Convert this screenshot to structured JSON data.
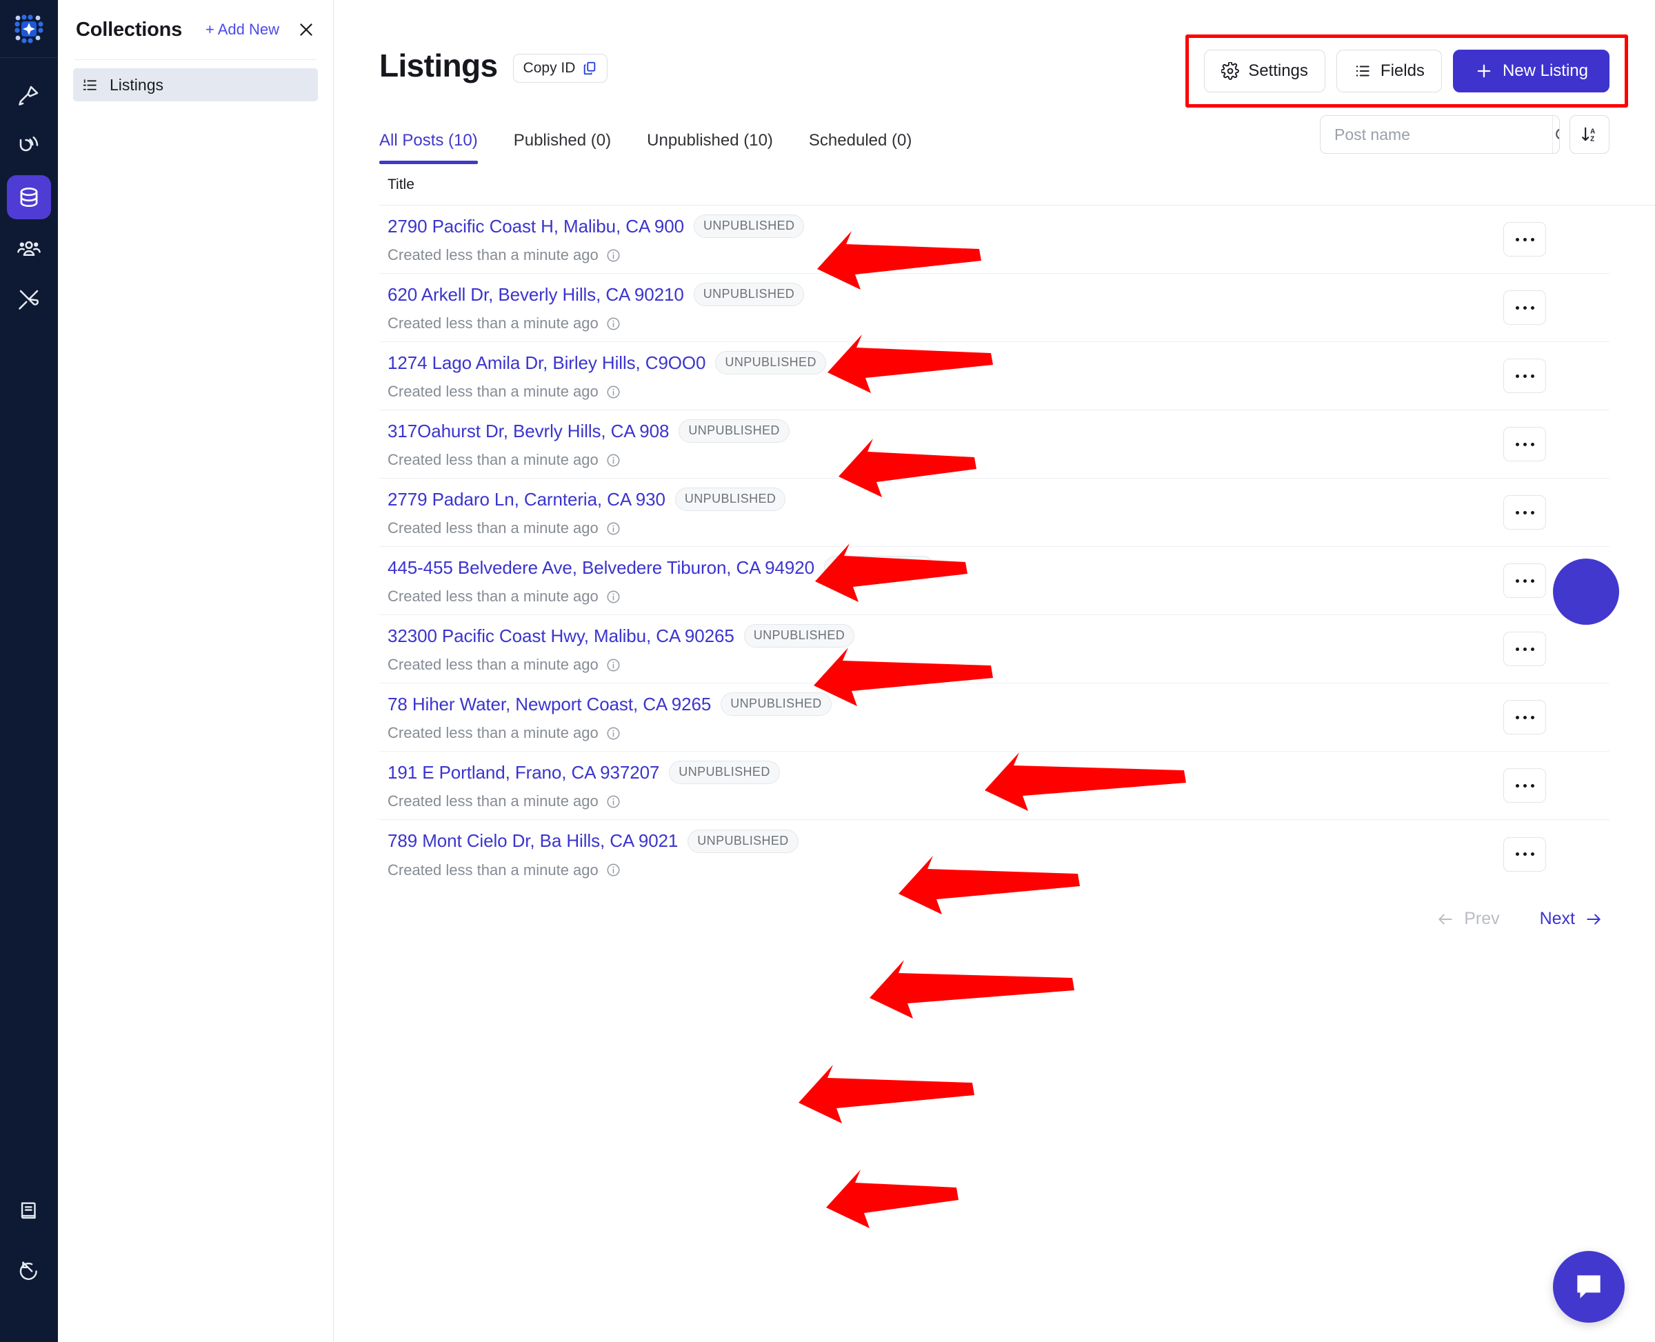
{
  "sidebar_rail": {
    "logo_icon": "app-logo-icon",
    "items": [
      {
        "icon": "designer-pen-icon",
        "active": false
      },
      {
        "icon": "signal-loop-icon",
        "active": false
      },
      {
        "icon": "database-icon",
        "active": true
      },
      {
        "icon": "users-icon",
        "active": false
      },
      {
        "icon": "tools-icon",
        "active": false
      }
    ],
    "bottom_items": [
      {
        "icon": "book-docs-icon"
      },
      {
        "icon": "arrow-circle-icon"
      }
    ]
  },
  "collections": {
    "title": "Collections",
    "add_new_label": "+ Add New",
    "close_icon": "close-icon",
    "items": [
      {
        "label": "Listings",
        "icon": "list-icon",
        "selected": true
      }
    ]
  },
  "header": {
    "page_title": "Listings",
    "copy_id_label": "Copy ID",
    "copy_id_icon": "copy-icon",
    "settings_label": "Settings",
    "settings_icon": "gear-icon",
    "fields_label": "Fields",
    "fields_icon": "list-lines-icon",
    "new_listing_label": "New Listing",
    "new_listing_icon": "plus-icon",
    "accent_color": "#3E33CC",
    "annotation_color": "#FF0000"
  },
  "tabs": [
    {
      "label": "All Posts (10)",
      "active": true
    },
    {
      "label": "Published (0)",
      "active": false
    },
    {
      "label": "Unpublished (10)",
      "active": false
    },
    {
      "label": "Scheduled (0)",
      "active": false
    }
  ],
  "search": {
    "placeholder": "Post name",
    "value": "",
    "search_icon": "search-icon",
    "sort_icon": "sort-az-icon"
  },
  "table": {
    "columns": [
      "Title"
    ],
    "rows": [
      {
        "title": "2790 Pacific Coast H, Malibu, CA 900",
        "status": "UNPUBLISHED",
        "meta": "Created less than a minute ago"
      },
      {
        "title": "620 Arkell Dr, Beverly Hills, CA 90210",
        "status": "UNPUBLISHED",
        "meta": "Created less than a minute ago"
      },
      {
        "title": "1274 Lago Amila Dr, Birley Hills, C9OO0",
        "status": "UNPUBLISHED",
        "meta": "Created less than a minute ago"
      },
      {
        "title": "317Oahurst Dr, Bevrly Hills, CA 908",
        "status": "UNPUBLISHED",
        "meta": "Created less than a minute ago"
      },
      {
        "title": "2779 Padaro Ln, Carnteria, CA 930",
        "status": "UNPUBLISHED",
        "meta": "Created less than a minute ago"
      },
      {
        "title": "445-455 Belvedere Ave, Belvedere Tiburon, CA 94920",
        "status": "UNPUBLISHED",
        "meta": "Created less than a minute ago"
      },
      {
        "title": "32300 Pacific Coast Hwy, Malibu, CA 90265",
        "status": "UNPUBLISHED",
        "meta": "Created less than a minute ago"
      },
      {
        "title": "78 Hiher Water, Newport Coast, CA 9265",
        "status": "UNPUBLISHED",
        "meta": "Created less than a minute ago"
      },
      {
        "title": "191 E Portland, Frano, CA 937207",
        "status": "UNPUBLISHED",
        "meta": "Created less than a minute ago"
      },
      {
        "title": "789 Mont Cielo Dr, Ba Hills, CA 9021",
        "status": "UNPUBLISHED",
        "meta": "Created less than a minute ago"
      }
    ],
    "row_menu_icon": "ellipsis-icon",
    "info_icon": "info-icon"
  },
  "pagination": {
    "prev_label": "Prev",
    "next_label": "Next",
    "prev_enabled": false,
    "next_enabled": true
  },
  "floating": {
    "chat_icon": "chat-bubble-icon"
  }
}
